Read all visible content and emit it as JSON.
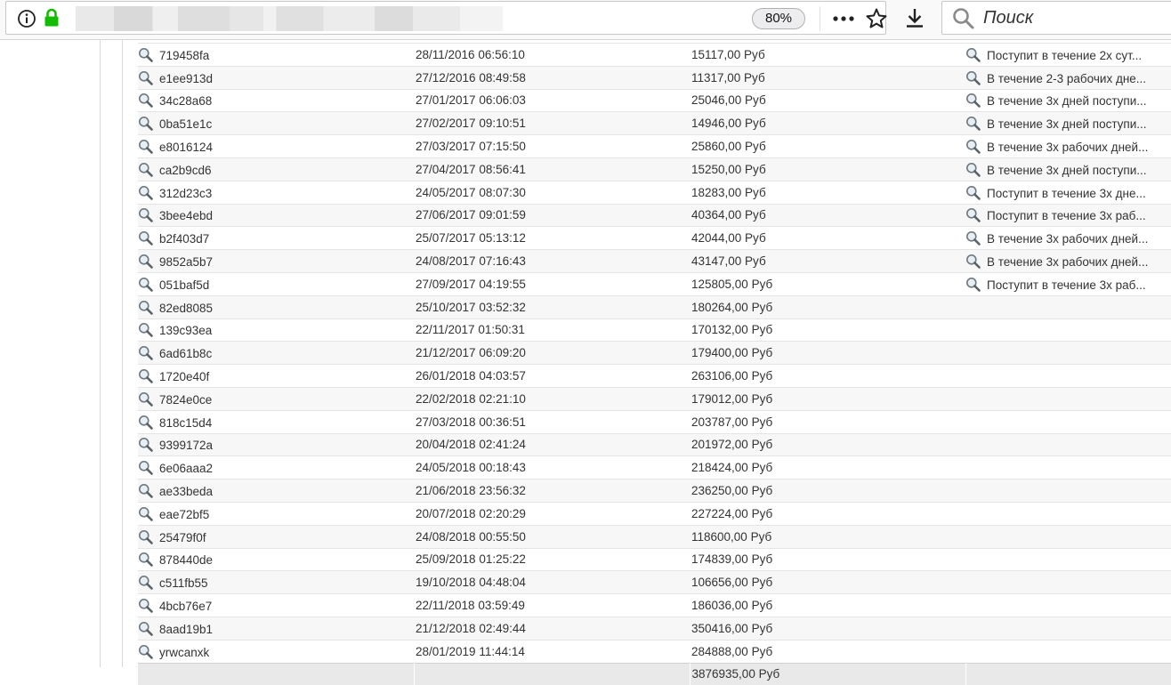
{
  "browser": {
    "zoom": "80%",
    "search_placeholder": "Поиск"
  },
  "payments": {
    "rows": [
      {
        "id": "719458fa",
        "date": "28/11/2016 06:56:10",
        "amount": "15117,00 Руб",
        "status": "Поступит в течение 2х сут..."
      },
      {
        "id": "e1ee913d",
        "date": "27/12/2016 08:49:58",
        "amount": "11317,00 Руб",
        "status": "В течение 2-3 рабочих дне..."
      },
      {
        "id": "34c28a68",
        "date": "27/01/2017 06:06:03",
        "amount": "25046,00 Руб",
        "status": "В течение 3х дней поступи..."
      },
      {
        "id": "0ba51e1c",
        "date": "27/02/2017 09:10:51",
        "amount": "14946,00 Руб",
        "status": "В течение 3х дней поступи..."
      },
      {
        "id": "e8016124",
        "date": "27/03/2017 07:15:50",
        "amount": "25860,00 Руб",
        "status": "В течение 3х рабочих дней..."
      },
      {
        "id": "ca2b9cd6",
        "date": "27/04/2017 08:56:41",
        "amount": "15250,00 Руб",
        "status": "В течение 3х дней поступи..."
      },
      {
        "id": "312d23c3",
        "date": "24/05/2017 08:07:30",
        "amount": "18283,00 Руб",
        "status": "Поступит в течение 3х дне..."
      },
      {
        "id": "3bee4ebd",
        "date": "27/06/2017 09:01:59",
        "amount": "40364,00 Руб",
        "status": "Поступит в течение 3х раб..."
      },
      {
        "id": "b2f403d7",
        "date": "25/07/2017 05:13:12",
        "amount": "42044,00 Руб",
        "status": "В течение 3х рабочих дней..."
      },
      {
        "id": "9852a5b7",
        "date": "24/08/2017 07:16:43",
        "amount": "43147,00 Руб",
        "status": "В течение 3х рабочих дней..."
      },
      {
        "id": "051baf5d",
        "date": "27/09/2017 04:19:55",
        "amount": "125805,00 Руб",
        "status": "Поступит в течение 3х раб..."
      },
      {
        "id": "82ed8085",
        "date": "25/10/2017 03:52:32",
        "amount": "180264,00 Руб",
        "status": ""
      },
      {
        "id": "139c93ea",
        "date": "22/11/2017 01:50:31",
        "amount": "170132,00 Руб",
        "status": ""
      },
      {
        "id": "6ad61b8c",
        "date": "21/12/2017 06:09:20",
        "amount": "179400,00 Руб",
        "status": ""
      },
      {
        "id": "1720e40f",
        "date": "26/01/2018 04:03:57",
        "amount": "263106,00 Руб",
        "status": ""
      },
      {
        "id": "7824e0ce",
        "date": "22/02/2018 02:21:10",
        "amount": "179012,00 Руб",
        "status": ""
      },
      {
        "id": "818c15d4",
        "date": "27/03/2018 00:36:51",
        "amount": "203787,00 Руб",
        "status": ""
      },
      {
        "id": "9399172a",
        "date": "20/04/2018 02:41:24",
        "amount": "201972,00 Руб",
        "status": ""
      },
      {
        "id": "6e06aaa2",
        "date": "24/05/2018 00:18:43",
        "amount": "218424,00 Руб",
        "status": ""
      },
      {
        "id": "ae33beda",
        "date": "21/06/2018 23:56:32",
        "amount": "236250,00 Руб",
        "status": ""
      },
      {
        "id": "eae72bf5",
        "date": "20/07/2018 02:20:29",
        "amount": "227224,00 Руб",
        "status": ""
      },
      {
        "id": "25479f0f",
        "date": "24/08/2018 00:55:50",
        "amount": "118600,00 Руб",
        "status": ""
      },
      {
        "id": "878440de",
        "date": "25/09/2018 01:25:22",
        "amount": "174839,00 Руб",
        "status": ""
      },
      {
        "id": "c511fb55",
        "date": "19/10/2018 04:48:04",
        "amount": "106656,00 Руб",
        "status": ""
      },
      {
        "id": "4bcb76e7",
        "date": "22/11/2018 03:59:49",
        "amount": "186036,00 Руб",
        "status": ""
      },
      {
        "id": "8aad19b1",
        "date": "21/12/2018 02:49:44",
        "amount": "350416,00 Руб",
        "status": ""
      },
      {
        "id": "yrwcanxk",
        "date": "28/01/2019 11:44:14",
        "amount": "284888,00 Руб",
        "status": ""
      }
    ],
    "total": "3876935,00 Руб"
  },
  "icons": {
    "address_bar": [
      "info-icon",
      "lock-icon"
    ],
    "toolbar": [
      "page-actions-icon",
      "bookmark-star-icon",
      "download-icon",
      "search-icon"
    ],
    "row": "magnifier-icon"
  },
  "colors": {
    "lock": "#12bc00",
    "row_alt": "#f7f7f7",
    "total_row": "#e9e9e9"
  }
}
